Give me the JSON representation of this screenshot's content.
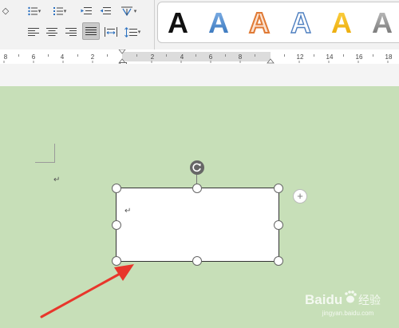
{
  "ruler": {
    "labels": [
      "8",
      "6",
      "4",
      "2",
      "2",
      "4",
      "6",
      "8",
      "12",
      "14",
      "16",
      "18"
    ]
  },
  "page": {
    "paragraph_mark": "↵",
    "textbox_paragraph_mark": "↵"
  },
  "gallery": {
    "styles": [
      {
        "letter": "A",
        "style": "black-bold"
      },
      {
        "letter": "A",
        "style": "blue-gradient"
      },
      {
        "letter": "A",
        "style": "orange-outline"
      },
      {
        "letter": "A",
        "style": "blue-outline"
      },
      {
        "letter": "A",
        "style": "gold-gradient"
      },
      {
        "letter": "A",
        "style": "gray-gradient"
      }
    ]
  },
  "watermark": {
    "brand": "Baidu",
    "cn": "经验",
    "url": "jingyan.baidu.com"
  },
  "colors": {
    "accent_arrow": "#e8362b",
    "page_background": "#c7dfb8",
    "selection": "#333333"
  }
}
